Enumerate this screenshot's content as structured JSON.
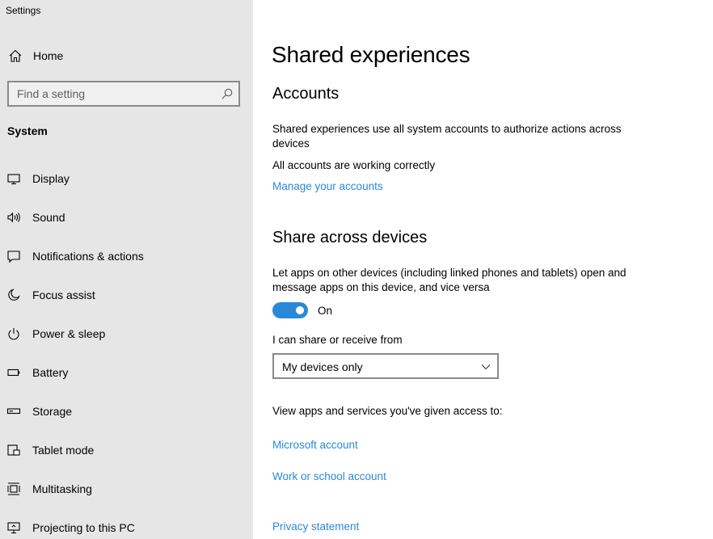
{
  "window": {
    "title": "Settings"
  },
  "sidebar": {
    "home_label": "Home",
    "search_placeholder": "Find a setting",
    "section": "System",
    "items": [
      {
        "label": "Display",
        "icon": "display-icon"
      },
      {
        "label": "Sound",
        "icon": "sound-icon"
      },
      {
        "label": "Notifications & actions",
        "icon": "notifications-icon"
      },
      {
        "label": "Focus assist",
        "icon": "moon-icon"
      },
      {
        "label": "Power & sleep",
        "icon": "power-icon"
      },
      {
        "label": "Battery",
        "icon": "battery-icon"
      },
      {
        "label": "Storage",
        "icon": "storage-icon"
      },
      {
        "label": "Tablet mode",
        "icon": "tablet-mode-icon"
      },
      {
        "label": "Multitasking",
        "icon": "multitasking-icon"
      },
      {
        "label": "Projecting to this PC",
        "icon": "projecting-icon"
      }
    ]
  },
  "main": {
    "title": "Shared experiences",
    "accounts": {
      "heading": "Accounts",
      "description": "Shared experiences use all system accounts to authorize actions across devices",
      "status": "All accounts are working correctly",
      "manage_link": "Manage your accounts"
    },
    "share": {
      "heading": "Share across devices",
      "description": "Let apps on other devices (including linked phones and tablets) open and message apps on this device, and vice versa",
      "toggle_state": "On",
      "toggle_on": true,
      "dropdown_label": "I can share or receive from",
      "dropdown_value": "My devices only",
      "access_text": "View apps and services you've given access to:",
      "microsoft_link": "Microsoft account",
      "work_link": "Work or school account"
    },
    "privacy_link": "Privacy statement"
  },
  "colors": {
    "accent": "#2b88d8",
    "sidebar_bg": "#e6e6e6",
    "link": "#2b88d8"
  }
}
